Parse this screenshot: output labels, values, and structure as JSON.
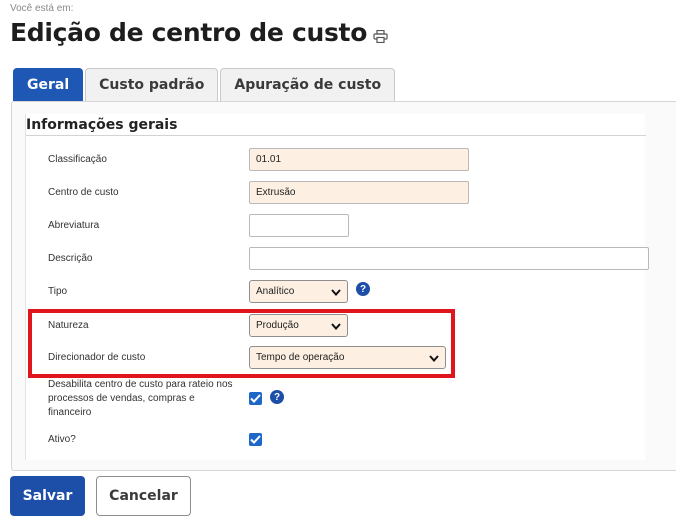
{
  "breadcrumb": "Você está em:",
  "page_title": "Edição de centro de custo",
  "icons": {
    "print": "print-icon",
    "chevron": "chevron-down-icon",
    "help": "help-icon",
    "check": "check-icon"
  },
  "colors": {
    "primary": "#1e4fa8",
    "tab_active": "#1e58b4",
    "field_bg": "#fdf0e2",
    "highlight": "#e0161e"
  },
  "tabs": [
    {
      "label": "Geral",
      "active": true
    },
    {
      "label": "Custo padrão",
      "active": false
    },
    {
      "label": "Apuração de custo",
      "active": false
    }
  ],
  "section": {
    "title": "Informações gerais"
  },
  "form": {
    "classificacao": {
      "label": "Classificação",
      "value": "01.01"
    },
    "centro_custo": {
      "label": "Centro de custo",
      "value": "Extrusão"
    },
    "abreviatura": {
      "label": "Abreviatura",
      "value": ""
    },
    "descricao": {
      "label": "Descrição",
      "value": ""
    },
    "tipo": {
      "label": "Tipo",
      "value": "Analítico"
    },
    "natureza": {
      "label": "Natureza",
      "value": "Produção"
    },
    "direcionador": {
      "label": "Direcionador de custo",
      "value": "Tempo de operação"
    },
    "desabilita": {
      "label": "Desabilita centro de custo para rateio nos processos de vendas, compras e financeiro",
      "checked": true
    },
    "ativo": {
      "label": "Ativo?",
      "checked": true
    }
  },
  "help_glyph": "?",
  "buttons": {
    "save": "Salvar",
    "cancel": "Cancelar"
  }
}
